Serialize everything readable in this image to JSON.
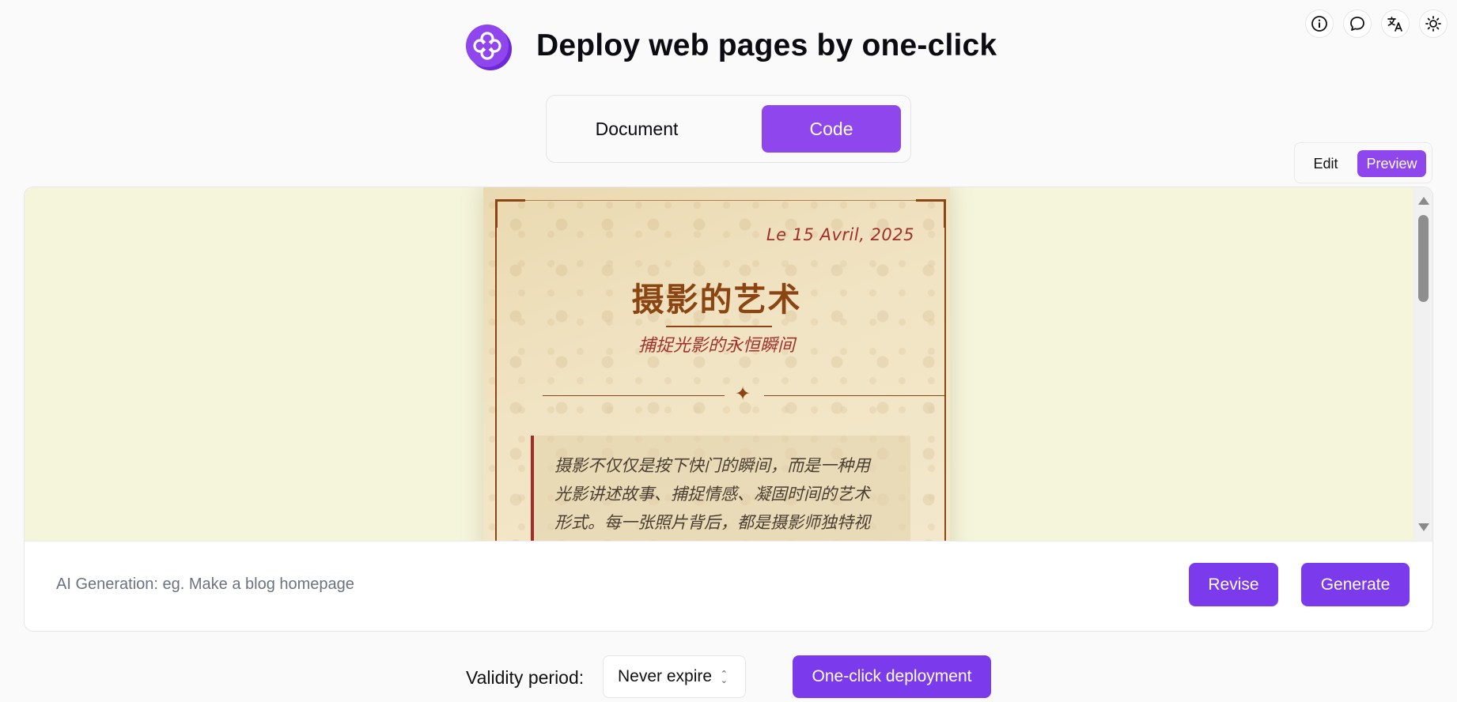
{
  "header": {
    "title": "Deploy web pages by one-click",
    "logo_icon": "clover-logo-icon",
    "accent_color": "#7c3aed",
    "icons": [
      "info-icon",
      "chat-icon",
      "translate-icon",
      "sun-icon"
    ]
  },
  "mode_toggle": {
    "options": [
      "Document",
      "Code"
    ],
    "selected": "Code"
  },
  "editor_toggle": {
    "edit_label": "Edit",
    "preview_label": "Preview",
    "selected": "Preview"
  },
  "preview": {
    "background_color": "#f5f5dc",
    "date": "Le 15 Avril, 2025",
    "title": "摄影的艺术",
    "subtitle": "捕捉光影的永恒瞬间",
    "ornament": "✦",
    "quote_lines": [
      "摄影不仅仅是按下快门的瞬间，而是一种用",
      "光影讲述故事、捕捉情感、凝固时间的艺术",
      "形式。每一张照片背后，都是摄影师独特视"
    ],
    "text_color": "#8b4513",
    "accent_color": "#a0312a"
  },
  "prompt": {
    "placeholder": "AI Generation: eg. Make a blog homepage",
    "value": "",
    "revise_label": "Revise",
    "generate_label": "Generate"
  },
  "footer": {
    "validity_label": "Validity period",
    "validity_colon": ":",
    "validity_value": "Never expire",
    "deploy_label": "One-click deployment"
  }
}
